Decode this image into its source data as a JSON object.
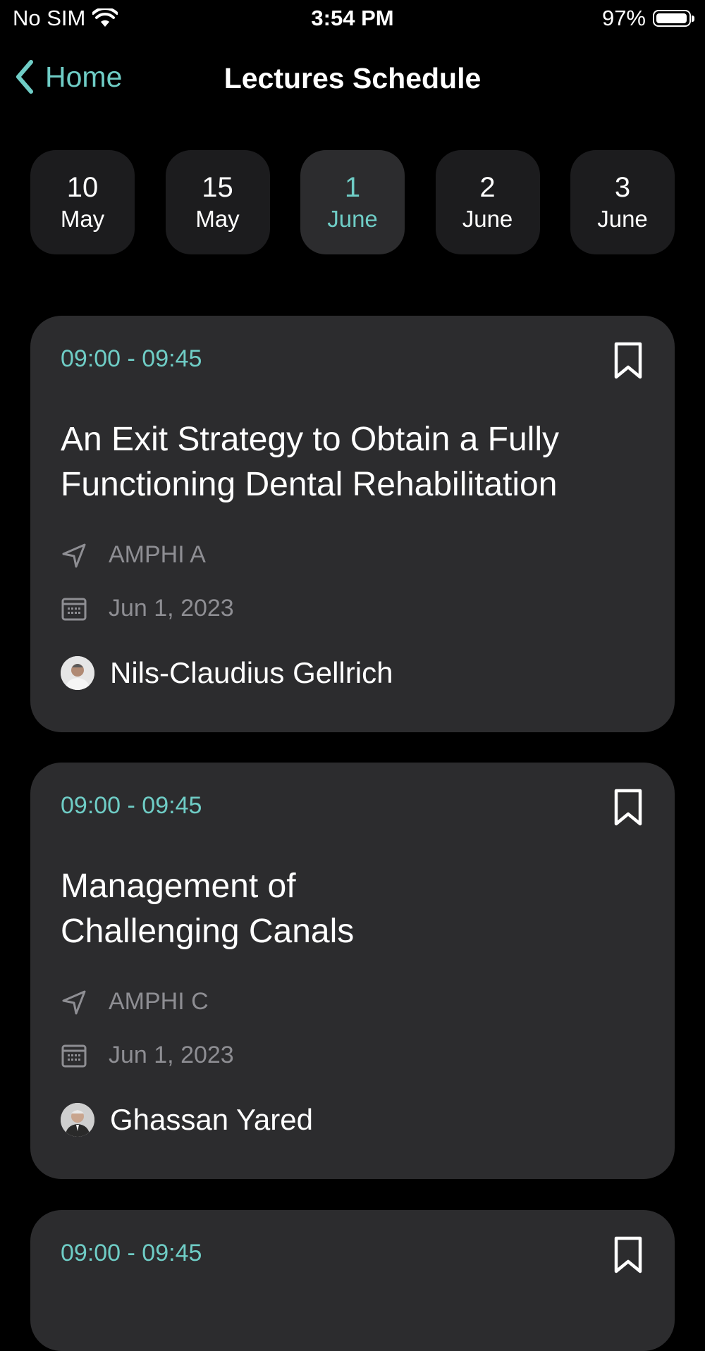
{
  "status_bar": {
    "carrier": "No SIM",
    "time": "3:54 PM",
    "battery": "97%",
    "battery_level": 0.97
  },
  "nav": {
    "back_label": "Home",
    "title": "Lectures Schedule"
  },
  "dates": [
    {
      "day": "10",
      "month": "May",
      "selected": false
    },
    {
      "day": "15",
      "month": "May",
      "selected": false
    },
    {
      "day": "1",
      "month": "June",
      "selected": true
    },
    {
      "day": "2",
      "month": "June",
      "selected": false
    },
    {
      "day": "3",
      "month": "June",
      "selected": false
    }
  ],
  "lectures": [
    {
      "time": "09:00 - 09:45",
      "title": "An Exit Strategy to Obtain a Fully Functioning Dental Rehabilitation",
      "location": "AMPHI A",
      "date": "Jun 1, 2023",
      "speaker": "Nils-Claudius Gellrich"
    },
    {
      "time": "09:00 - 09:45",
      "title": "Management of Challenging Canals",
      "location": "AMPHI C",
      "date": "Jun 1, 2023",
      "speaker": "Ghassan Yared"
    },
    {
      "time": "09:00 - 09:45"
    }
  ],
  "colors": {
    "accent": "#6fcdc6",
    "card": "#2c2c2e",
    "chip": "#1c1c1e",
    "chip_selected": "#2c2c2e",
    "muted_text": "#8e8e93"
  }
}
